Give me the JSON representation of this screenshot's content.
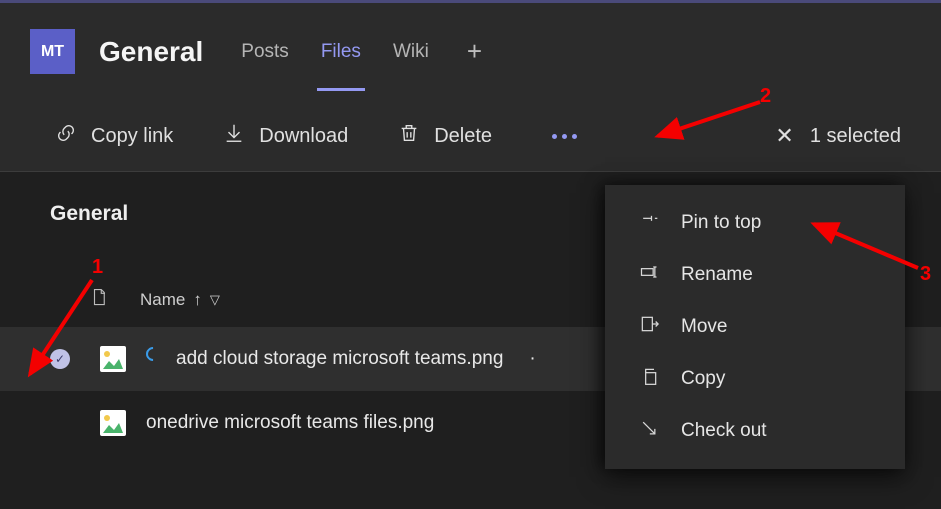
{
  "team_badge": "MT",
  "channel": "General",
  "tabs": {
    "posts": "Posts",
    "files": "Files",
    "wiki": "Wiki"
  },
  "actions": {
    "copy_link": "Copy link",
    "download": "Download",
    "delete": "Delete"
  },
  "selection": {
    "clear_label": "✕",
    "text": "1 selected"
  },
  "folder_title": "General",
  "columns": {
    "name": "Name"
  },
  "files": [
    {
      "name": "add cloud storage microsoft teams.png"
    },
    {
      "name": "onedrive microsoft teams files.png"
    }
  ],
  "menu": {
    "pin": "Pin to top",
    "rename": "Rename",
    "move": "Move",
    "copy": "Copy",
    "checkout": "Check out"
  },
  "annotations": {
    "n1": "1",
    "n2": "2",
    "n3": "3"
  }
}
